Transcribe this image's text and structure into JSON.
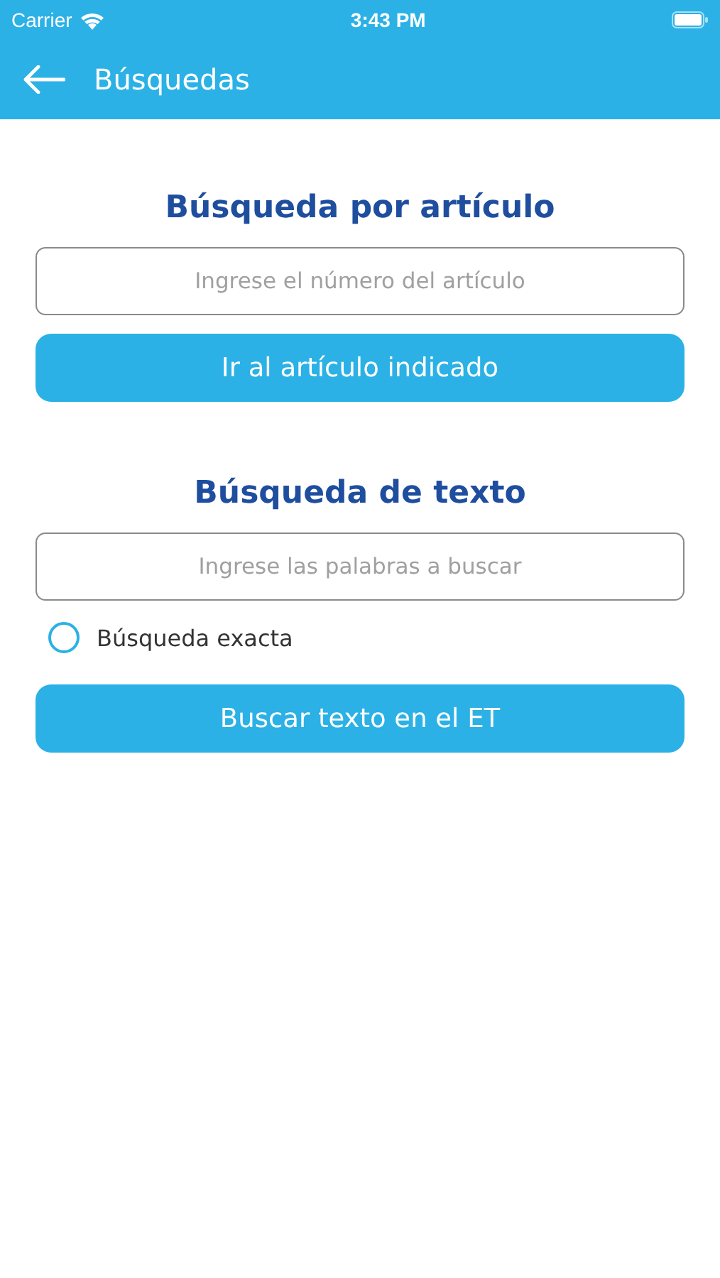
{
  "status_bar": {
    "carrier": "Carrier",
    "time": "3:43 PM"
  },
  "header": {
    "title": "Búsquedas"
  },
  "sections": [
    {
      "heading": "Búsqueda por artículo",
      "field": {
        "placeholder": "Ingrese el número del artículo"
      },
      "button": "Ir al artículo indicado"
    },
    {
      "heading": "Búsqueda de texto",
      "field": {
        "placeholder": "Ingrese las palabras a buscar"
      },
      "option": {
        "label": "Búsqueda exacta",
        "selected": false
      },
      "button": "Buscar texto en el ET"
    }
  ]
}
